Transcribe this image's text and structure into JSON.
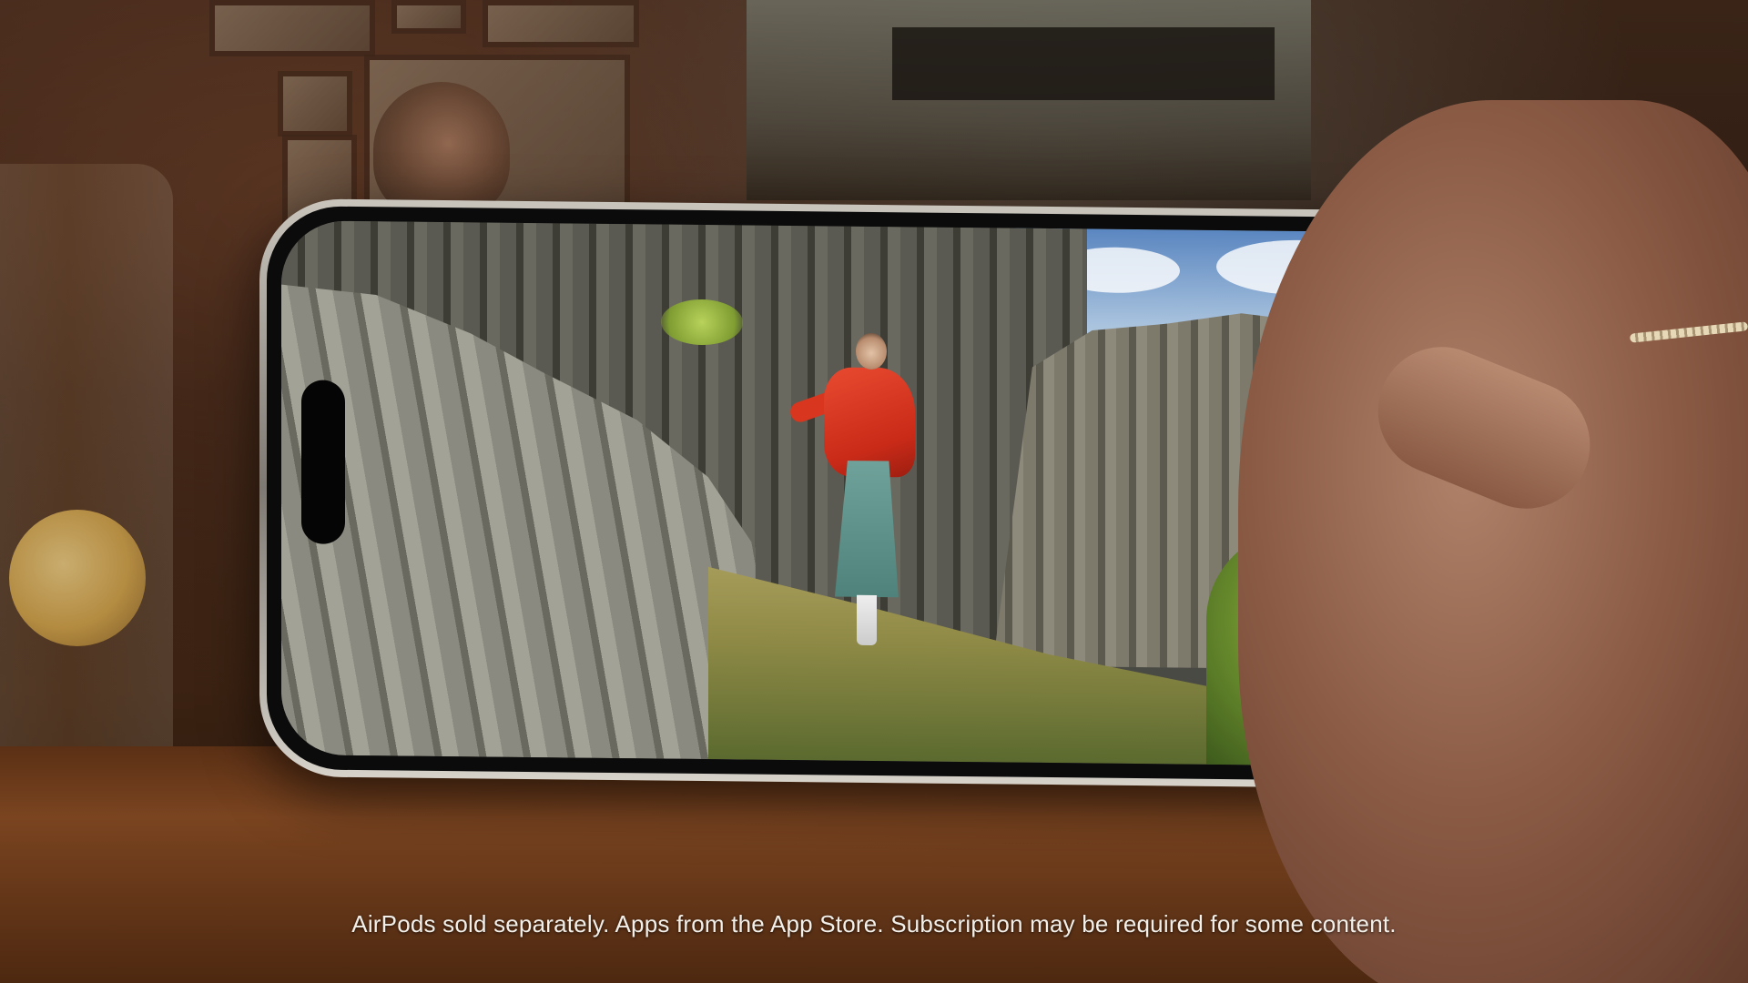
{
  "caption": {
    "text": "AirPods sold separately. Apps from the App Store. Subscription may be required for some content."
  },
  "scene": {
    "setting": "cafe",
    "phone_content": "woman in red jacket on rocky cliff"
  },
  "colors": {
    "caption_text": "#f2efe9",
    "jacket": "#e84a30",
    "skirt": "#6fa29a",
    "sky": "#5a86c0"
  }
}
